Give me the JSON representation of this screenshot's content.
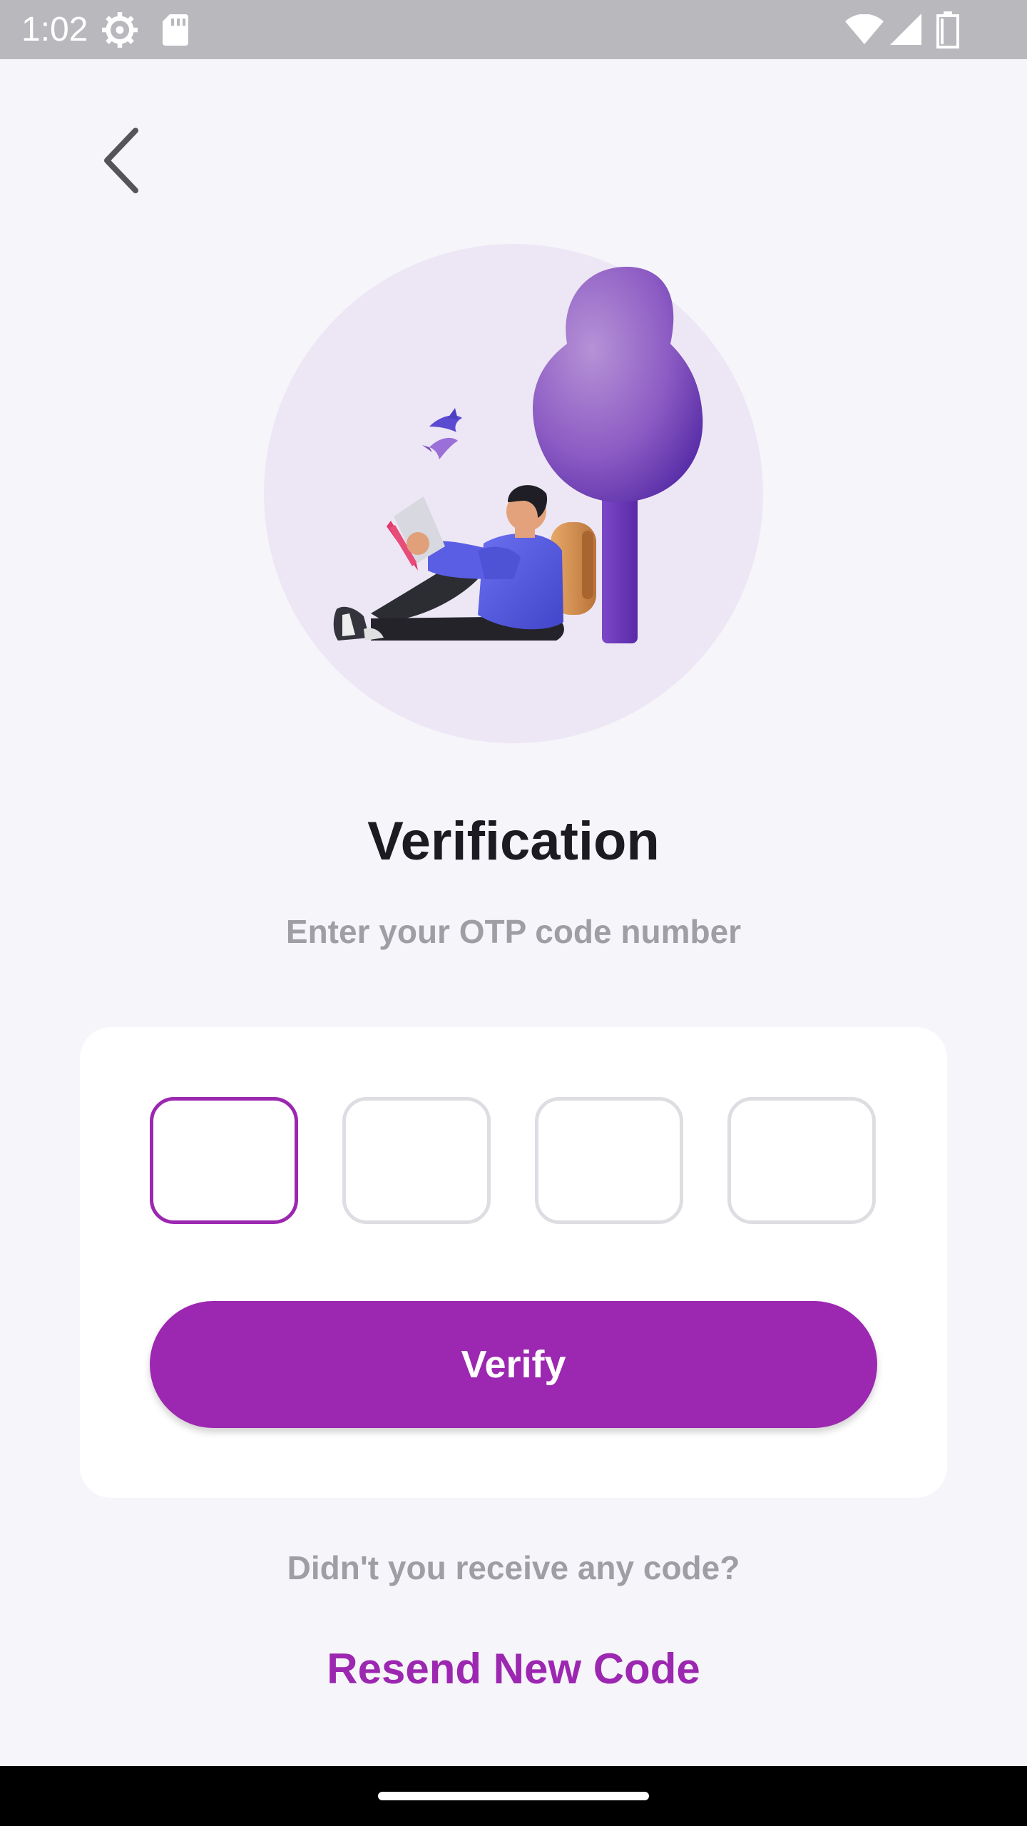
{
  "status_bar": {
    "time": "1:02",
    "icons": [
      "gear-icon",
      "sd-card-icon",
      "wifi-icon",
      "signal-icon",
      "battery-icon"
    ]
  },
  "header": {
    "back_icon": "chevron-left-icon"
  },
  "hero": {
    "illustration": "person-reading-under-tree-illustration"
  },
  "main": {
    "title": "Verification",
    "subtitle": "Enter your OTP code number"
  },
  "otp": {
    "digits": [
      "",
      "",
      "",
      ""
    ],
    "active_index": 0
  },
  "actions": {
    "verify_label": "Verify",
    "resend_prompt": "Didn't you receive any code?",
    "resend_label": "Resend New Code"
  },
  "colors": {
    "accent": "#9c27b0",
    "background": "#f6f5fa",
    "card": "#ffffff",
    "muted_text": "#9e9ea4",
    "title_text": "#1c1b21",
    "box_border": "#dedde2",
    "status_bar": "#b9b8bd"
  }
}
